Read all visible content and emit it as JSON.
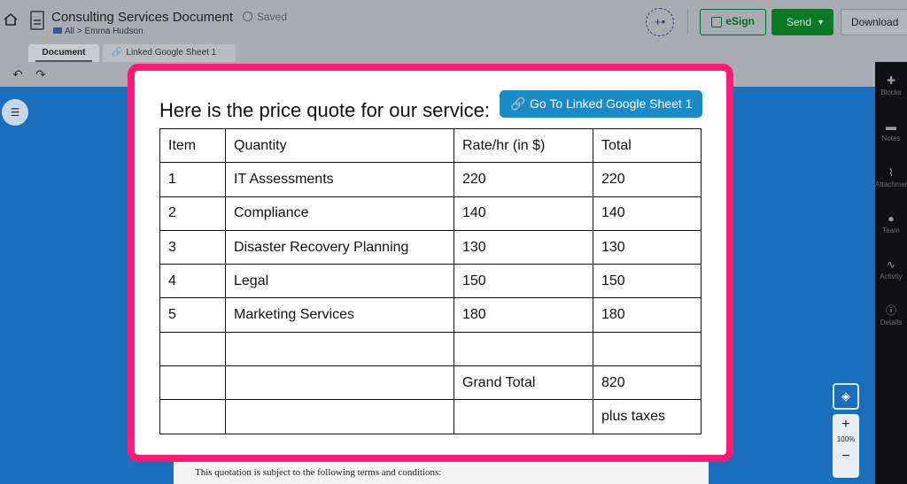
{
  "header": {
    "doc_title": "Consulting Services Document",
    "saved": "Saved",
    "crumb_folder": "All",
    "crumb_sep": ">",
    "crumb_user": "Emma Hudson",
    "esign": "eSign",
    "send": "Send",
    "download": "Download"
  },
  "tabs": [
    {
      "label": "Document"
    },
    {
      "label": "Linked Google Sheet 1"
    }
  ],
  "sidebar_right": [
    "Blocks",
    "Notes",
    "Attachments",
    "Team",
    "Activity",
    "Details"
  ],
  "zoom": {
    "level": "100%",
    "plus": "+",
    "minus": "−"
  },
  "document": {
    "heading": "Here is the price quote for our service:",
    "sheet_button": "Go To Linked Google Sheet 1",
    "table": {
      "headers": [
        "Item",
        "Quantity",
        "Rate/hr (in $)",
        "Total"
      ],
      "rows": [
        [
          "1",
          "IT Assessments",
          "220",
          "220"
        ],
        [
          "2",
          "Compliance",
          "140",
          "140"
        ],
        [
          "3",
          "Disaster Recovery Planning",
          "130",
          "130"
        ],
        [
          "4",
          "Legal",
          "150",
          "150"
        ],
        [
          "5",
          "Marketing Services",
          "180",
          "180"
        ],
        [
          "",
          "",
          "",
          ""
        ],
        [
          "",
          "",
          "Grand Total",
          "820"
        ],
        [
          "",
          "",
          "",
          "plus taxes"
        ]
      ]
    },
    "terms_text": "This quotation is subject to the following terms and conditions:"
  },
  "colors": {
    "highlight": "#ff1a75",
    "accent": "#1a8bc7",
    "send_green": "#0c7a25",
    "canvas_blue": "#1a6fbd"
  }
}
